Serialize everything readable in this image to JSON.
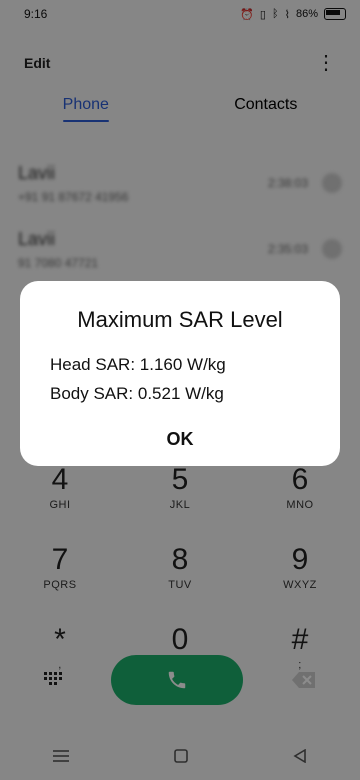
{
  "status_bar": {
    "time": "9:16",
    "battery_text": "86%"
  },
  "header": {
    "edit_label": "Edit"
  },
  "tabs": [
    {
      "label": "Phone",
      "active": true
    },
    {
      "label": "Contacts",
      "active": false
    }
  ],
  "call_list": [
    {
      "name": "Lavii",
      "sub": "+91 91 87672 41956",
      "time": "2:38:03"
    },
    {
      "name": "Lavii",
      "sub": "91 7080 47721",
      "time": "2:35:03"
    }
  ],
  "keypad": {
    "row1": [
      {
        "digit": "4",
        "letters": "GHI"
      },
      {
        "digit": "5",
        "letters": "JKL"
      },
      {
        "digit": "6",
        "letters": "MNO"
      }
    ],
    "row2": [
      {
        "digit": "7",
        "letters": "PQRS"
      },
      {
        "digit": "8",
        "letters": "TUV"
      },
      {
        "digit": "9",
        "letters": "WXYZ"
      }
    ],
    "row3": [
      {
        "digit": "*",
        "letters": ","
      },
      {
        "digit": "0",
        "letters": "+"
      },
      {
        "digit": "#",
        "letters": ";"
      }
    ]
  },
  "dialog": {
    "title": "Maximum SAR Level",
    "head_sar": "Head SAR: 1.160 W/kg",
    "body_sar": "Body SAR: 0.521 W/kg",
    "ok_label": "OK"
  },
  "colors": {
    "accent": "#2d5bd4",
    "call_button": "#1cae6b"
  }
}
